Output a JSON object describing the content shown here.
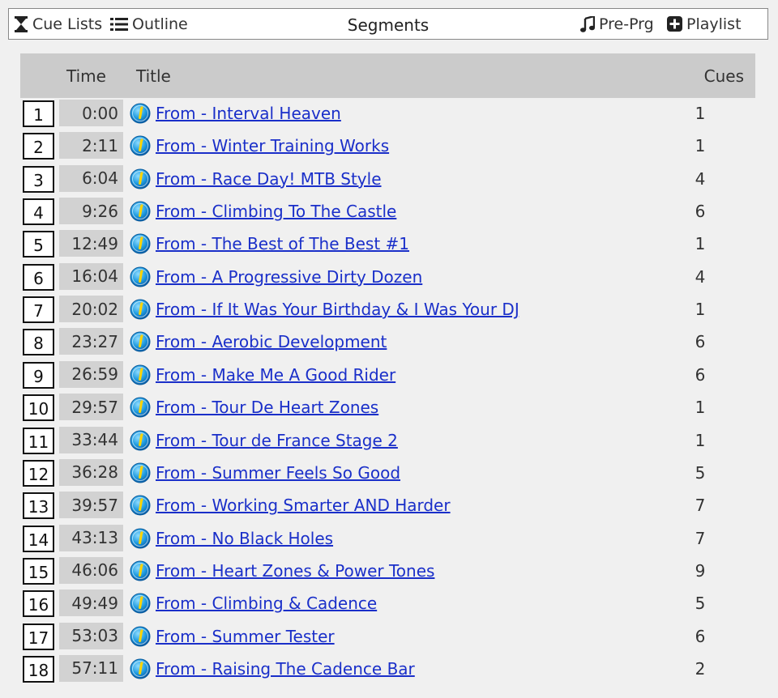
{
  "toolbar": {
    "cue_lists_label": "Cue Lists",
    "outline_label": "Outline",
    "title": "Segments",
    "pre_prg_label": "Pre-Prg",
    "playlist_label": "Playlist"
  },
  "table": {
    "headers": {
      "time": "Time",
      "title": "Title",
      "cues": "Cues"
    },
    "rows": [
      {
        "num": "1",
        "time": "0:00",
        "title": "From - Interval Heaven",
        "cues": "1"
      },
      {
        "num": "2",
        "time": "2:11",
        "title": "From - Winter Training Works",
        "cues": "1"
      },
      {
        "num": "3",
        "time": "6:04",
        "title": "From - Race Day! MTB Style",
        "cues": "4"
      },
      {
        "num": "4",
        "time": "9:26",
        "title": "From - Climbing To The Castle",
        "cues": "6"
      },
      {
        "num": "5",
        "time": "12:49",
        "title": "From - The Best of The Best #1",
        "cues": "1"
      },
      {
        "num": "6",
        "time": "16:04",
        "title": "From - A Progressive Dirty Dozen",
        "cues": "4"
      },
      {
        "num": "7",
        "time": "20:02",
        "title": "From - If It Was Your Birthday & I Was Your DJ",
        "cues": "1"
      },
      {
        "num": "8",
        "time": "23:27",
        "title": "From - Aerobic Development",
        "cues": "6"
      },
      {
        "num": "9",
        "time": "26:59",
        "title": "From - Make Me A Good Rider",
        "cues": "6"
      },
      {
        "num": "10",
        "time": "29:57",
        "title": "From - Tour De Heart Zones",
        "cues": "1"
      },
      {
        "num": "11",
        "time": "33:44",
        "title": "From - Tour de France Stage 2",
        "cues": "1"
      },
      {
        "num": "12",
        "time": "36:28",
        "title": "From - Summer Feels So Good",
        "cues": "5"
      },
      {
        "num": "13",
        "time": "39:57",
        "title": "From - Working Smarter AND Harder",
        "cues": "7"
      },
      {
        "num": "14",
        "time": "43:13",
        "title": "From - No Black Holes",
        "cues": "7"
      },
      {
        "num": "15",
        "time": "46:06",
        "title": "From - Heart Zones & Power Tones",
        "cues": "9"
      },
      {
        "num": "16",
        "time": "49:49",
        "title": "From - Climbing & Cadence",
        "cues": "5"
      },
      {
        "num": "17",
        "time": "53:03",
        "title": "From - Summer Tester",
        "cues": "6"
      },
      {
        "num": "18",
        "time": "57:11",
        "title": "From - Raising The Cadence Bar",
        "cues": "2"
      }
    ]
  },
  "colors": {
    "link": "#1a2fc9",
    "header_bg": "#cbcbcb",
    "time_bg": "#d2d2d2",
    "info_icon": "#1e9be0"
  },
  "icons": {
    "cue_lists": "hourglass-icon",
    "outline": "list-icon",
    "pre_prg": "music-note-icon",
    "playlist": "plus-square-icon",
    "row_info": "info-icon"
  }
}
